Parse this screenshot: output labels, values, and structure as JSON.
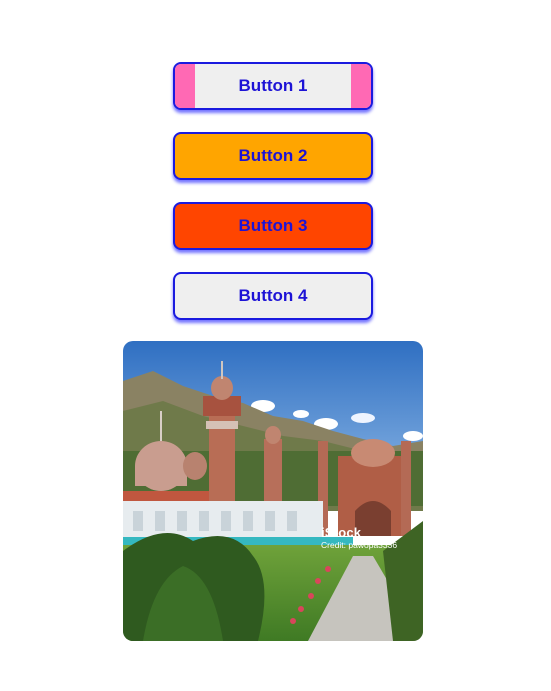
{
  "buttons": {
    "b1": "Button 1",
    "b2": "Button 2",
    "b3": "Button 3",
    "b4": "Button 4"
  },
  "image": {
    "alt": "Mosque with minarets and domes beside a garden path in a mountain valley",
    "watermark": {
      "brand": "iStock",
      "credit": "Credit: pawopa3336"
    }
  }
}
